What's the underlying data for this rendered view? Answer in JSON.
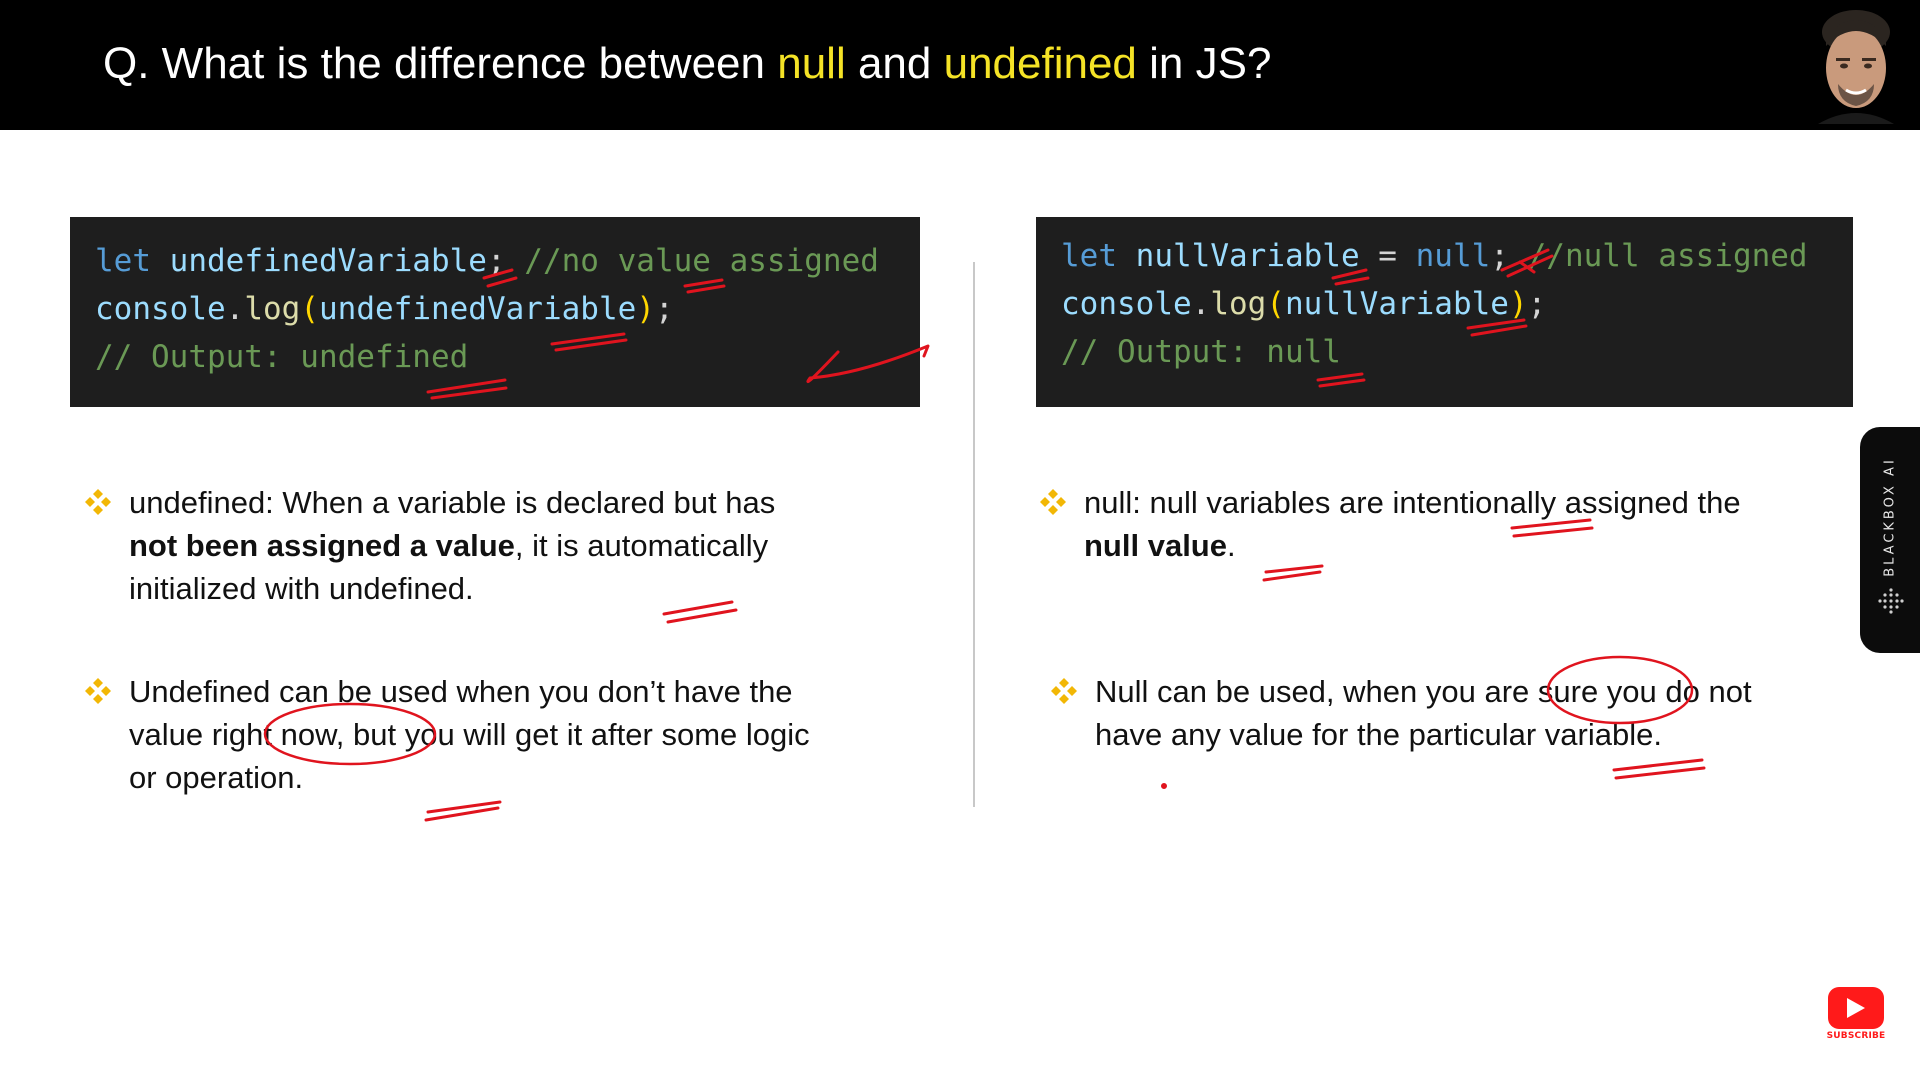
{
  "header": {
    "prefix": "Q. What is the difference between ",
    "keyword_null": "null",
    "middle": " and ",
    "keyword_undefined": "undefined",
    "suffix": " in JS?",
    "keyword_color": "#f5e326"
  },
  "code_left": {
    "line1": {
      "keyword": "let",
      "identifier": "undefinedVariable",
      "semicolon": ";",
      "comment": "//no value assigned"
    },
    "line2": {
      "object": "console",
      "dot": ".",
      "method": "log",
      "open_paren": "(",
      "argument": "undefinedVariable",
      "close_paren": ")",
      "semicolon": ";"
    },
    "line3": {
      "comment": "// Output: undefined"
    }
  },
  "code_right": {
    "line1": {
      "keyword": "let",
      "identifier": "nullVariable",
      "operator": " = ",
      "value": "null",
      "semicolon": ";",
      "comment": "//null assigned"
    },
    "line2": {
      "object": "console",
      "dot": ".",
      "method": "log",
      "open_paren": "(",
      "argument": "nullVariable",
      "close_paren": ")",
      "semicolon": ";"
    },
    "line3": {
      "comment": "// Output: null"
    }
  },
  "bullets_left": [
    {
      "before": "undefined: When a variable is declared but has ",
      "bold": "not been assigned a value",
      "after": ", it is automatically initialized with undefined."
    },
    {
      "text": "Undefined can be used when you don’t have the value right now, but you will get it after some logic or operation."
    }
  ],
  "bullets_right": [
    {
      "before": "null: null variables are intentionally assigned the ",
      "bold": "null value",
      "after": "."
    },
    {
      "text": "Null can be used, when you are sure you do not have any value for the particular variable."
    }
  ],
  "side_tab": {
    "label": "BLACKBOX AI",
    "icon": "blackbox-dots-icon"
  },
  "subscribe": {
    "label": "SUBSCRIBE",
    "icon": "youtube-play-icon",
    "color": "#ff1a1a"
  },
  "colors": {
    "annotation_ink": "#e0141e",
    "bullet_icon": "#f2b705",
    "code_background": "#1e1e1e"
  }
}
